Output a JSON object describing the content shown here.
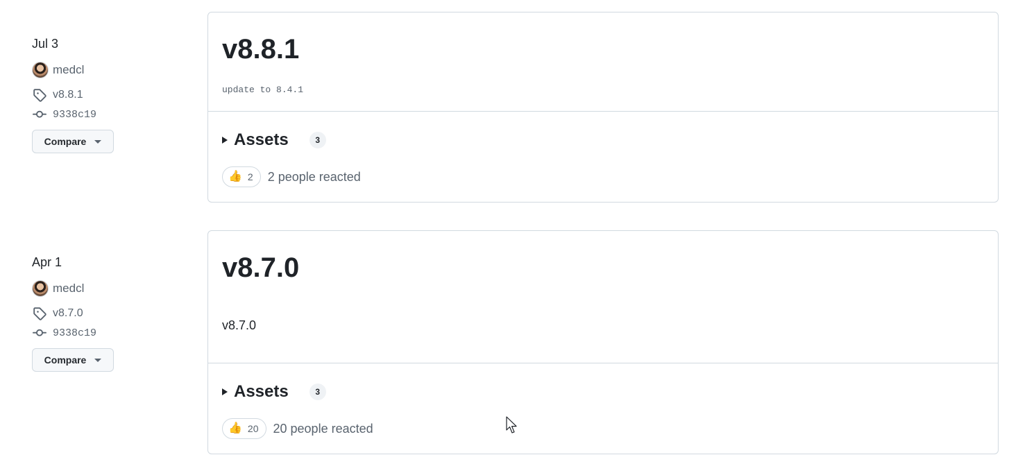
{
  "releases": [
    {
      "date": "Jul 3",
      "author": "medcl",
      "tag": "v8.8.1",
      "commit": "9338c19",
      "compare_label": "Compare",
      "title": "v8.8.1",
      "body": "update to 8.4.1",
      "assets_label": "Assets",
      "assets_count": "3",
      "reaction_emoji": "👍",
      "reaction_count": "2",
      "reacted_text": "2 people reacted"
    },
    {
      "date": "Apr 1",
      "author": "medcl",
      "tag": "v8.7.0",
      "commit": "9338c19",
      "compare_label": "Compare",
      "title": "v8.7.0",
      "body": "v8.7.0",
      "assets_label": "Assets",
      "assets_count": "3",
      "reaction_emoji": "👍",
      "reaction_count": "20",
      "reacted_text": "20 people reacted"
    }
  ],
  "icons": {
    "tag": "tag-icon",
    "commit": "git-commit-icon",
    "caret": "triangle-down-icon",
    "disclosure": "triangle-right-icon",
    "cursor": "mouse-pointer-icon"
  }
}
